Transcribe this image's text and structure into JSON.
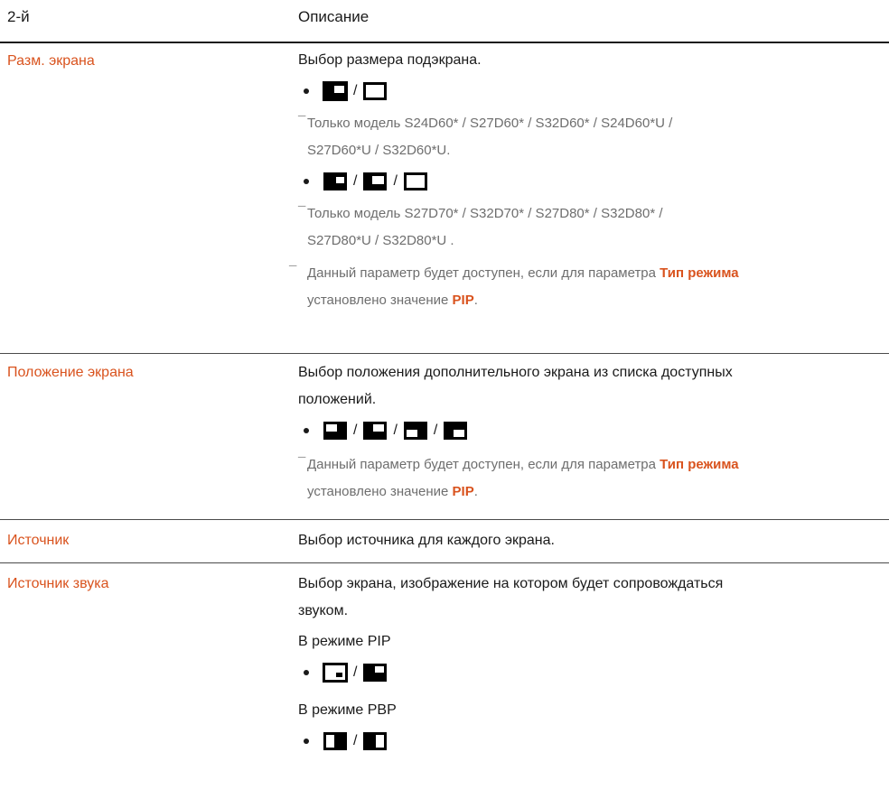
{
  "header": {
    "col1": "2-й",
    "col2": "Описание"
  },
  "rows": [
    {
      "label": "Разм. экрана",
      "text": "Выбор размера подэкрана.",
      "note1": [
        "Только модель S24D60* / S27D60* / S32D60* / S24D60*U /",
        "S27D60*U / S32D60*U."
      ],
      "note2": [
        "Только модель S27D70* / S32D70* / S27D80* / S32D80* /",
        "S27D80*U / S32D80*U ."
      ],
      "note3": {
        "a": "Данный параметр будет доступен, если для параметра ",
        "b": "Тип режима",
        "c": "установлено значение ",
        "d": "PIP",
        "e": "."
      }
    },
    {
      "label": "Положение экрана",
      "text": [
        "Выбор положения дополнительного экрана из списка доступных",
        "положений."
      ],
      "note": {
        "a": "Данный параметр будет доступен, если для параметра ",
        "b": "Тип режима",
        "c": "установлено значение ",
        "d": "PIP",
        "e": "."
      }
    },
    {
      "label": "Источник",
      "text": "Выбор источника для каждого экрана."
    },
    {
      "label": "Источник звука",
      "text": [
        "Выбор экрана, изображение на котором будет сопровождаться",
        "звуком."
      ],
      "mode_pip": "В режиме PIP",
      "mode_pbp": "В режиме PBP"
    }
  ],
  "separator": "/",
  "icons": {
    "size_2": [
      "screen-size-large-icon",
      "screen-size-full-icon"
    ],
    "size_3": [
      "screen-size-large-icon",
      "screen-size-medium-icon",
      "screen-size-full-icon"
    ],
    "position": [
      "position-top-left-icon",
      "position-top-right-icon",
      "position-bottom-left-icon",
      "position-bottom-right-icon"
    ],
    "sound_pip": [
      "sound-pip-sub-icon",
      "sound-pip-main-icon"
    ],
    "sound_pbp": [
      "sound-pbp-right-icon",
      "sound-pbp-left-icon"
    ]
  },
  "colors": {
    "accent": "#d9531e",
    "text": "#1a1a1a",
    "note": "#6e6e6e"
  }
}
